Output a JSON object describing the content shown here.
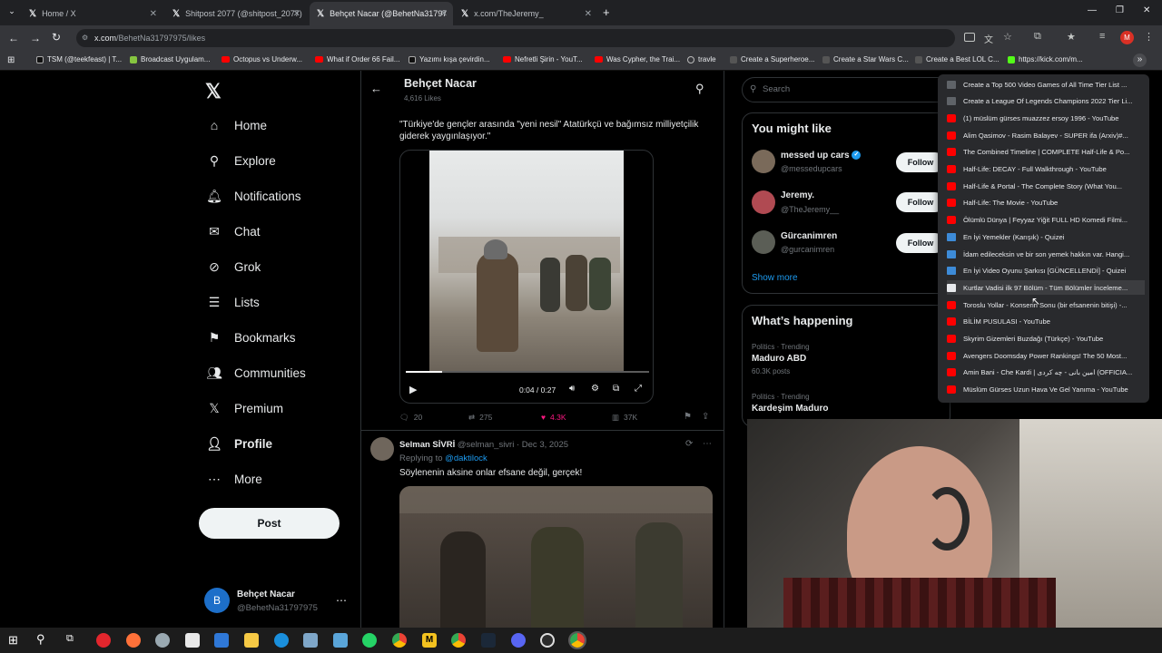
{
  "browser": {
    "tabs": [
      {
        "title": "Home / X",
        "active": false
      },
      {
        "title": "Shitpost 2077 (@shitpost_2077)",
        "active": false
      },
      {
        "title": "Behçet Nacar (@BehetNa31797",
        "active": true
      },
      {
        "title": "x.com/TheJeremy_",
        "active": false
      }
    ],
    "new_tab": "+",
    "address_domain": "x.com",
    "address_path": "/BehetNa31797975/likes",
    "bookmarks": [
      {
        "label": "TSM (@teekfeast) | T...",
        "icon": "tiktok"
      },
      {
        "label": "Broadcast Uygulam...",
        "icon": "twitch"
      },
      {
        "label": "Octopus vs Underw...",
        "icon": "youtube"
      },
      {
        "label": "What if Order 66 Fail...",
        "icon": "youtube"
      },
      {
        "label": "Yazımı kışa çevirdin...",
        "icon": "tiktok"
      },
      {
        "label": "Nefretli Şirin - YouT...",
        "icon": "youtube"
      },
      {
        "label": "Was Cypher, the Trai...",
        "icon": "youtube"
      },
      {
        "label": "travle",
        "icon": "globe"
      },
      {
        "label": "Create a Superheroe...",
        "icon": "tiermaker"
      },
      {
        "label": "Create a Star Wars C...",
        "icon": "tiermaker"
      },
      {
        "label": "Create a Best LOL C...",
        "icon": "tiermaker"
      },
      {
        "label": "https://kick.com/m...",
        "icon": "kick"
      }
    ],
    "overflow_chevron": "»"
  },
  "x_nav": {
    "items": [
      {
        "label": "Home",
        "icon": "home-icon"
      },
      {
        "label": "Explore",
        "icon": "search-icon"
      },
      {
        "label": "Notifications",
        "icon": "bell-icon"
      },
      {
        "label": "Chat",
        "icon": "mail-icon"
      },
      {
        "label": "Grok",
        "icon": "grok-icon"
      },
      {
        "label": "Lists",
        "icon": "list-icon"
      },
      {
        "label": "Bookmarks",
        "icon": "bookmark-icon"
      },
      {
        "label": "Communities",
        "icon": "people-icon"
      },
      {
        "label": "Premium",
        "icon": "x-icon"
      },
      {
        "label": "Profile",
        "icon": "person-icon"
      },
      {
        "label": "More",
        "icon": "more-icon"
      }
    ],
    "post_button": "Post",
    "account": {
      "name": "Behçet Nacar",
      "handle": "@BehetNa31797975",
      "initial": "B"
    }
  },
  "main": {
    "header": {
      "name": "Behçet Nacar",
      "likes": "4,616 Likes"
    },
    "post1": {
      "text": "\"Türkiye'de gençler arasında \"yeni nesil\" Atatürkçü ve bağımsız milliyetçilik giderek yaygınlaşıyor.\"",
      "video_time": "0:04 / 0:27",
      "video_progress": 0.148,
      "replies": "20",
      "reposts": "275",
      "likes": "4.3K",
      "views": "37K"
    },
    "post2": {
      "author": "Selman SİVRİ",
      "handle": "@selman_sivri",
      "date": "Dec 3, 2025",
      "replying_prefix": "Replying to",
      "replying_to": "@daktilock",
      "text": "Söylenenin aksine onlar efsane değil, gerçek!"
    }
  },
  "right": {
    "search_placeholder": "Search",
    "you_might_like": {
      "title": "You might like",
      "accounts": [
        {
          "name": "messed up cars",
          "handle": "@messedupcars",
          "verified": true
        },
        {
          "name": "Jeremy.",
          "handle": "@TheJeremy__",
          "verified": false
        },
        {
          "name": "Gürcanimren",
          "handle": "@gurcanimren",
          "verified": false
        }
      ],
      "follow_label": "Follow",
      "show_more": "Show more"
    },
    "whats_happening": {
      "title": "What’s happening",
      "trends": [
        {
          "context": "Politics · Trending",
          "name": "Maduro ABD",
          "posts": "60.3K posts"
        },
        {
          "context": "Politics · Trending",
          "name": "Kardeşim Maduro",
          "posts": ""
        }
      ]
    }
  },
  "dropdown": {
    "items": [
      {
        "label": "Create a Top 500 Video Games of All Time Tier List ...",
        "icon": "tiermaker"
      },
      {
        "label": "Create a League Of Legends Champions 2022 Tier Li...",
        "icon": "tiermaker"
      },
      {
        "label": "(1) müslüm gürses muazzez ersoy 1996 - YouTube",
        "icon": "youtube"
      },
      {
        "label": "Alim Qasimov - Rasim Balayev - SUPER ifa (Arxiv)#...",
        "icon": "youtube"
      },
      {
        "label": "The Combined Timeline | COMPLETE Half-Life & Po...",
        "icon": "youtube"
      },
      {
        "label": "Half-Life: DECAY - Full Walkthrough - YouTube",
        "icon": "youtube"
      },
      {
        "label": "Half-Life & Portal - The Complete Story (What You...",
        "icon": "youtube"
      },
      {
        "label": "Half-Life: The Movie - YouTube",
        "icon": "youtube"
      },
      {
        "label": "Ölümlü Dünya | Feyyaz Yiğit FULL HD Komedi Filmi...",
        "icon": "youtube"
      },
      {
        "label": "En İyi Yemekler (Karışık) - Quizei",
        "icon": "quizei"
      },
      {
        "label": "İdam edileceksin ve bir son yemek hakkın var. Hangi...",
        "icon": "quizei"
      },
      {
        "label": "En İyi Video Oyunu Şarkısı [GÜNCELLENDİ] - Quizei",
        "icon": "quizei"
      },
      {
        "label": "Kurtlar Vadisi ilk 97 Bölüm - Tüm Bölümler İnceleme...",
        "icon": "page",
        "highlighted": true
      },
      {
        "label": "Toroslu Yollar - Konserin Sonu (bir efsanenin bitişi) -...",
        "icon": "youtube"
      },
      {
        "label": "BİLİM PUSULASI - YouTube",
        "icon": "youtube"
      },
      {
        "label": "Skyrim Gizemleri Buzdağı (Türkçe) - YouTube",
        "icon": "youtube"
      },
      {
        "label": "Avengers Doomsday Power Rankings! The 50 Most...",
        "icon": "youtube"
      },
      {
        "label": "Amin Bani - Che Kardi | امین بانی - چه کردی (OFFICIA...",
        "icon": "youtube"
      },
      {
        "label": "Müslüm Gürses Uzun Hava Ve Gel Yanıma - YouTube",
        "icon": "youtube"
      }
    ]
  },
  "colors": {
    "accent": "#1d9bf0",
    "like": "#f91880",
    "youtube": "#ff0000"
  }
}
